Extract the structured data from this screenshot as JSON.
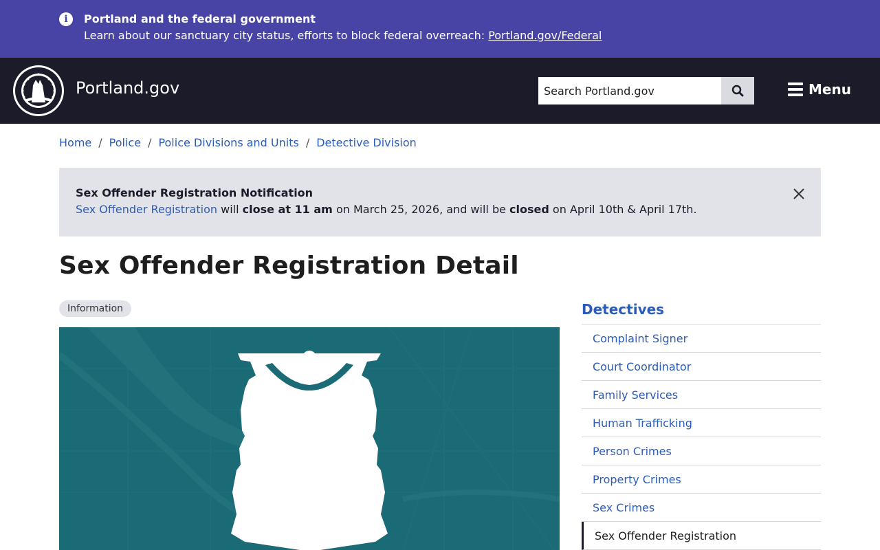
{
  "federal_banner": {
    "title": "Portland and the federal government",
    "text": "Learn about our sanctuary city status, efforts to block federal overreach: ",
    "link": "Portland.gov/Federal"
  },
  "header": {
    "site_name": "Portland.gov",
    "search_placeholder": "Search Portland.gov",
    "menu_label": "Menu"
  },
  "breadcrumb": [
    "Home",
    "Police",
    "Police Divisions and Units",
    "Detective Division"
  ],
  "alert": {
    "title": "Sex Offender Registration Notification",
    "link": "Sex Offender Registration",
    "part1": " will ",
    "bold1": "close at 11 am",
    "part2": " on March 25, 2026, and will be ",
    "bold2": "closed",
    "part3": " on April 10th & April 17th."
  },
  "page_title": "Sex Offender Registration Detail",
  "badge": "Information",
  "sidebar": {
    "title": "Detectives",
    "items": [
      "Complaint Signer",
      "Court Coordinator",
      "Family Services",
      "Human Trafficking",
      "Person Crimes",
      "Property Crimes",
      "Sex Crimes",
      "Sex Offender Registration"
    ],
    "active_index": 7
  },
  "colors": {
    "banner": "#4744a6",
    "header": "#1b1b2a",
    "link": "#2b5cb8",
    "hero": "#1a6b75"
  },
  "icons": [
    "info-icon",
    "seal-logo",
    "search-icon",
    "hamburger-icon",
    "close-icon",
    "police-badge-icon"
  ]
}
